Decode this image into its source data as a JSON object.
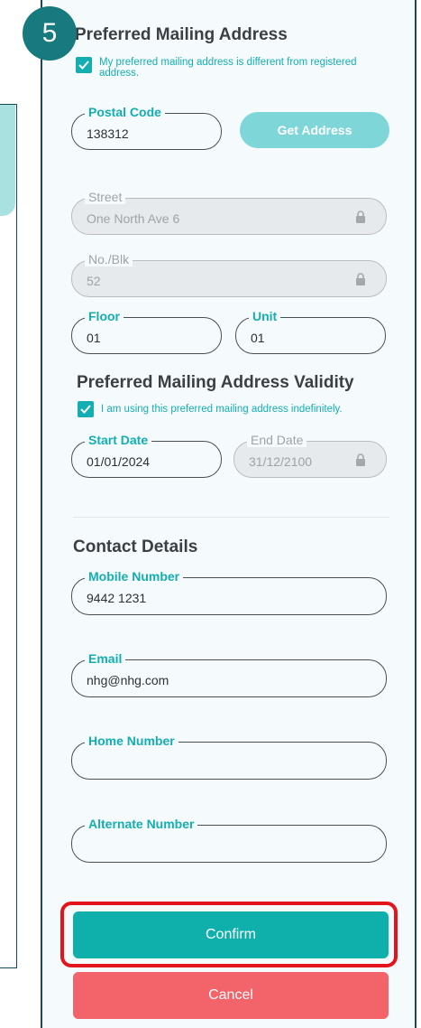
{
  "step_number": "5",
  "mailing": {
    "title": "Preferred Mailing Address",
    "different_checkbox_label": "My preferred mailing address is different from registered address.",
    "postal_code": {
      "label": "Postal Code",
      "value": "138312"
    },
    "get_address_label": "Get Address",
    "street": {
      "label": "Street",
      "value": "One North Ave 6"
    },
    "block": {
      "label": "No./Blk",
      "value": "52"
    },
    "floor": {
      "label": "Floor",
      "value": "01"
    },
    "unit": {
      "label": "Unit",
      "value": "01"
    }
  },
  "validity": {
    "title": "Preferred Mailing Address Validity",
    "indefinite_checkbox_label": "I am using this preferred mailing address indefinitely.",
    "start_date": {
      "label": "Start Date",
      "value": "01/01/2024"
    },
    "end_date": {
      "label": "End Date",
      "value": "31/12/2100"
    }
  },
  "contact": {
    "title": "Contact Details",
    "mobile": {
      "label": "Mobile Number",
      "value": "9442 1231"
    },
    "email": {
      "label": "Email",
      "value": "nhg@nhg.com"
    },
    "home": {
      "label": "Home Number",
      "value": ""
    },
    "alternate": {
      "label": "Alternate Number",
      "value": ""
    }
  },
  "actions": {
    "confirm_label": "Confirm",
    "cancel_label": "Cancel"
  },
  "colors": {
    "accent": "#14aeb2",
    "confirm": "#0fb0ab",
    "cancel": "#f2636a",
    "highlight": "#e4141b",
    "badge": "#167a7e"
  },
  "icons": {
    "check": "check-icon",
    "lock": "lock-icon"
  }
}
